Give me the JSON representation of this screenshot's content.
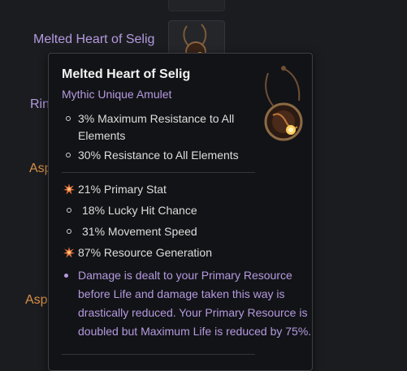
{
  "background": {
    "labels": [
      {
        "text": "Melted Heart of Selig",
        "color": "purple"
      },
      {
        "text": "Rin",
        "color": "purple"
      },
      {
        "text": "Asp",
        "color": "orange"
      },
      {
        "text": "Asp",
        "color": "orange"
      }
    ]
  },
  "tooltip": {
    "title": "Melted Heart of Selig",
    "subtitle": "Mythic Unique Amulet",
    "implicits": [
      {
        "line1": "3% Maximum Resistance to All",
        "line2": "Elements"
      },
      {
        "line1": "30% Resistance to All Elements"
      }
    ],
    "affixes": [
      {
        "text": "21% Primary Stat",
        "icon": "greater-affix-star-icon"
      },
      {
        "text": "18% Lucky Hit Chance",
        "icon": "affix-dot-icon"
      },
      {
        "text": "31% Movement Speed",
        "icon": "affix-dot-icon"
      },
      {
        "text": "87% Resource Generation",
        "icon": "greater-affix-star-icon"
      }
    ],
    "unique_power": {
      "lines": [
        "Damage is dealt to your Primary Resource",
        "before Life and damage taken this way is",
        "drastically reduced. Your Primary Resource is",
        "doubled but Maximum Life is reduced by 75%."
      ]
    },
    "colors": {
      "mythic": "#b69ae0",
      "greater_affix": "#e4743c",
      "legendary_label": "#d89048"
    }
  }
}
